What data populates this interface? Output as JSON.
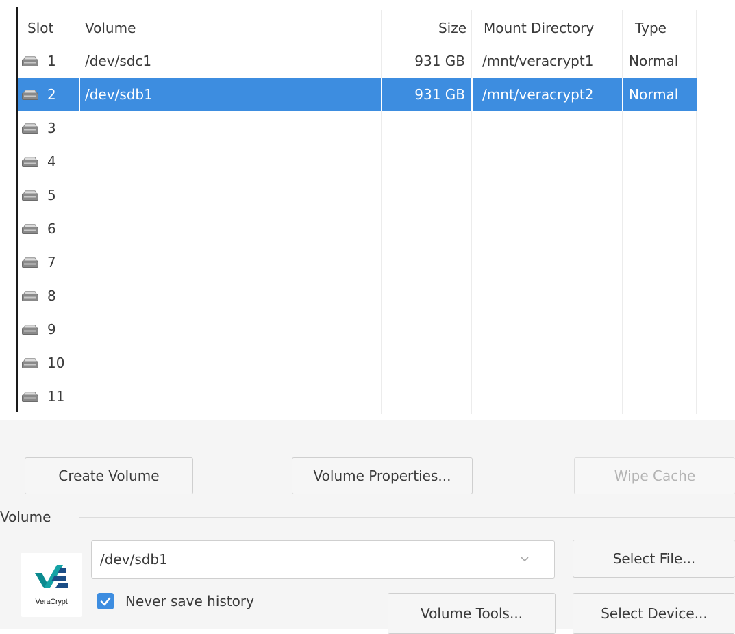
{
  "volume_list": {
    "columns": {
      "slot": "Slot",
      "volume": "Volume",
      "size": "Size",
      "mount_directory": "Mount Directory",
      "type": "Type"
    },
    "rows": [
      {
        "slot": "1",
        "volume": "/dev/sdc1",
        "size": "931 GB",
        "mount_directory": "/mnt/veracrypt1",
        "type": "Normal",
        "selected": false
      },
      {
        "slot": "2",
        "volume": "/dev/sdb1",
        "size": "931 GB",
        "mount_directory": "/mnt/veracrypt2",
        "type": "Normal",
        "selected": true
      },
      {
        "slot": "3",
        "volume": "",
        "size": "",
        "mount_directory": "",
        "type": "",
        "selected": false
      },
      {
        "slot": "4",
        "volume": "",
        "size": "",
        "mount_directory": "",
        "type": "",
        "selected": false
      },
      {
        "slot": "5",
        "volume": "",
        "size": "",
        "mount_directory": "",
        "type": "",
        "selected": false
      },
      {
        "slot": "6",
        "volume": "",
        "size": "",
        "mount_directory": "",
        "type": "",
        "selected": false
      },
      {
        "slot": "7",
        "volume": "",
        "size": "",
        "mount_directory": "",
        "type": "",
        "selected": false
      },
      {
        "slot": "8",
        "volume": "",
        "size": "",
        "mount_directory": "",
        "type": "",
        "selected": false
      },
      {
        "slot": "9",
        "volume": "",
        "size": "",
        "mount_directory": "",
        "type": "",
        "selected": false
      },
      {
        "slot": "10",
        "volume": "",
        "size": "",
        "mount_directory": "",
        "type": "",
        "selected": false
      },
      {
        "slot": "11",
        "volume": "",
        "size": "",
        "mount_directory": "",
        "type": "",
        "selected": false
      }
    ]
  },
  "buttons": {
    "create_volume": "Create Volume",
    "volume_properties": "Volume Properties...",
    "wipe_cache": "Wipe Cache",
    "select_file": "Select File...",
    "volume_tools": "Volume Tools...",
    "select_device": "Select Device..."
  },
  "volume_group": {
    "label": "Volume",
    "path_value": "/dev/sdb1",
    "never_save_history_label": "Never save history",
    "never_save_history_checked": true,
    "logo_text": "VeraCrypt"
  },
  "icons": {
    "drive": "drive-icon",
    "dropdown": "chevron-down-icon",
    "check": "check-icon",
    "logo": "veracrypt-logo"
  },
  "colors": {
    "selection": "#3d8de0",
    "logo_teal": "#0b8a8f",
    "logo_navy": "#1b4d86"
  }
}
